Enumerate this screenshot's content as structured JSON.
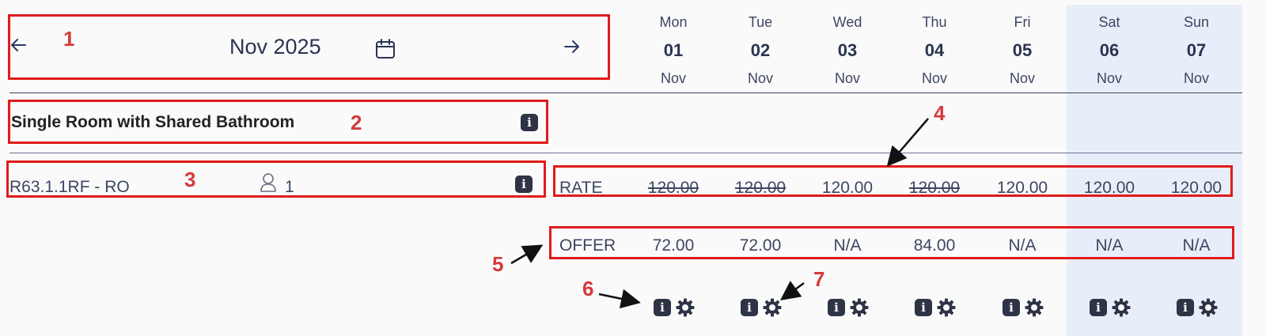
{
  "header": {
    "month_label": "Nov 2025",
    "prev_icon": "arrow-left-icon",
    "next_icon": "arrow-right-icon",
    "calendar_icon": "calendar-icon",
    "days": [
      {
        "name": "Mon",
        "num": "01",
        "mon": "Nov",
        "weekend": false
      },
      {
        "name": "Tue",
        "num": "02",
        "mon": "Nov",
        "weekend": false
      },
      {
        "name": "Wed",
        "num": "03",
        "mon": "Nov",
        "weekend": false
      },
      {
        "name": "Thu",
        "num": "04",
        "mon": "Nov",
        "weekend": false
      },
      {
        "name": "Fri",
        "num": "05",
        "mon": "Nov",
        "weekend": false
      },
      {
        "name": "Sat",
        "num": "06",
        "mon": "Nov",
        "weekend": true
      },
      {
        "name": "Sun",
        "num": "07",
        "mon": "Nov",
        "weekend": true
      }
    ]
  },
  "room": {
    "title": "Single Room with Shared Bathroom",
    "rate_code": "R63.1.1RF - RO",
    "occupancy": "1"
  },
  "rate_row": {
    "label": "RATE",
    "cells": [
      {
        "value": "120.00",
        "strikethrough": true
      },
      {
        "value": "120.00",
        "strikethrough": true
      },
      {
        "value": "120.00",
        "strikethrough": false
      },
      {
        "value": "120.00",
        "strikethrough": true
      },
      {
        "value": "120.00",
        "strikethrough": false
      },
      {
        "value": "120.00",
        "strikethrough": false
      },
      {
        "value": "120.00",
        "strikethrough": false
      }
    ]
  },
  "offer_row": {
    "label": "OFFER",
    "cells": [
      "72.00",
      "72.00",
      "N/A",
      "84.00",
      "N/A",
      "N/A",
      "N/A"
    ]
  },
  "annotations": [
    "1",
    "2",
    "3",
    "4",
    "5",
    "6",
    "7"
  ],
  "colors": {
    "annotation_red": "#e01b1b",
    "weekend_bg": "#e8eef9",
    "text_dark": "#2a3450",
    "icon_dark": "#2e3346"
  }
}
